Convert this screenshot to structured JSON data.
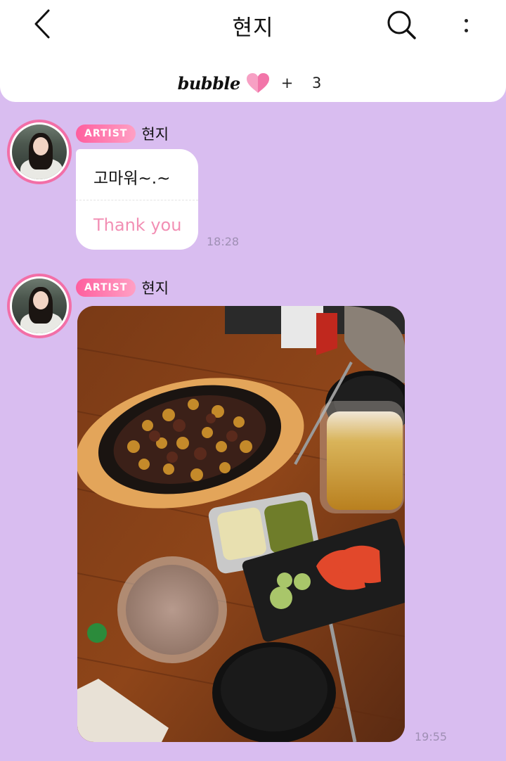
{
  "header": {
    "title": "현지",
    "brand": "bubble",
    "plus_count": "+ 3"
  },
  "messages": [
    {
      "badge": "ARTIST",
      "sender": "현지",
      "text": "고마워~.~",
      "translation": "Thank you",
      "time": "18:28"
    },
    {
      "badge": "ARTIST",
      "sender": "현지",
      "time": "19:55"
    }
  ],
  "colors": {
    "background": "#d9bdf0",
    "accent_pink": "#f26fa7",
    "translation_pink": "#f28fb4"
  }
}
